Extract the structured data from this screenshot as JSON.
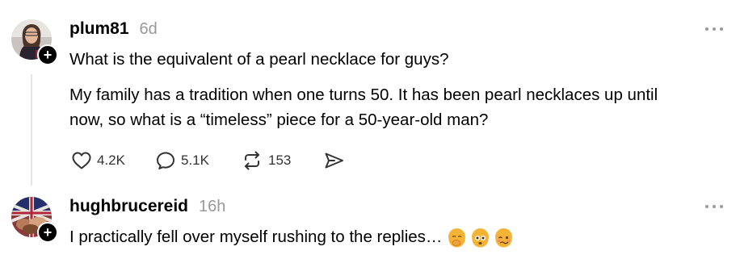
{
  "post": {
    "username": "plum81",
    "time": "6d",
    "title": "What is the equivalent of a pearl necklace for guys?",
    "body_line1": "My family has a tradition when one turns 50. It has been pearl necklaces up until",
    "body_line2": "now, so what is a “timeless” piece for a 50-year-old man?",
    "actions": {
      "likes": "4.2K",
      "comments": "5.1K",
      "reposts": "153"
    },
    "icons": [
      "heart-icon",
      "comment-icon",
      "repost-icon",
      "share-icon",
      "more-icon",
      "follow-plus-icon"
    ]
  },
  "reply": {
    "username": "hughbrucereid",
    "time": "16h",
    "text": "I practically fell over myself rushing to the replies…",
    "emojis": [
      "hand-over-mouth-emoji",
      "flushed-emoji",
      "woozy-emoji"
    ]
  },
  "colors": {
    "meta_gray": "#999999",
    "thread_line": "#e5e5e5",
    "emoji_yellow": "#f5b335"
  }
}
